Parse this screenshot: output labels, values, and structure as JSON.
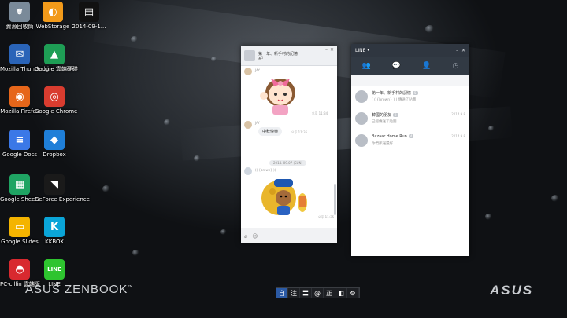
{
  "desktop": {
    "icons": [
      {
        "label": "資源回收筒",
        "color": "#7a8a99",
        "glyph": "🗑",
        "icon": "recycle-bin-icon"
      },
      {
        "label": "WebStorage",
        "color": "#f29a1a",
        "glyph": "◐",
        "icon": "webstorage-icon"
      },
      {
        "label": "2014-09-1...",
        "color": "#111111",
        "glyph": "▤",
        "icon": "screenshot-file-icon"
      },
      {
        "label": "Mozilla Thunderbird",
        "color": "#2a64b8",
        "glyph": "✉",
        "icon": "thunderbird-icon"
      },
      {
        "label": "Google 雲端硬碟",
        "color": "#1e9e55",
        "glyph": "▲",
        "icon": "google-drive-icon"
      },
      {
        "label": "Mozilla Firefox",
        "color": "#e6661a",
        "glyph": "◉",
        "icon": "firefox-icon"
      },
      {
        "label": "Google Chrome",
        "color": "#d93c2f",
        "glyph": "◎",
        "icon": "chrome-icon"
      },
      {
        "label": "Google Docs",
        "color": "#3b78e7",
        "glyph": "≡",
        "icon": "google-docs-icon"
      },
      {
        "label": "Dropbox",
        "color": "#1f7fd8",
        "glyph": "◆",
        "icon": "dropbox-icon"
      },
      {
        "label": "Google Sheets",
        "color": "#1fa463",
        "glyph": "▦",
        "icon": "google-sheets-icon"
      },
      {
        "label": "GeForce Experience",
        "color": "#1a1a1a",
        "glyph": "◥",
        "icon": "geforce-icon"
      },
      {
        "label": "Google Slides",
        "color": "#f4b400",
        "glyph": "▭",
        "icon": "google-slides-icon"
      },
      {
        "label": "KKBOX",
        "color": "#0aa5d8",
        "glyph": "K",
        "icon": "kkbox-icon"
      },
      {
        "label": "PC-cillin 雲端版",
        "color": "#d8292f",
        "glyph": "◓",
        "icon": "pc-cillin-icon"
      },
      {
        "label": "LINE",
        "color": "#2ec42f",
        "glyph": "LINE",
        "icon": "line-app-icon"
      }
    ],
    "brand_left": "ASUS ZENBOOK",
    "brand_left_tm": "™",
    "brand_right": "ASUS"
  },
  "chat_window": {
    "title": "第一年、新手村的記憶",
    "member_count": "▲5",
    "bubble_text": "中秋快樂",
    "date_label": "2014. 09.07 (SUN)",
    "sticker_caption": "(( {brown} ))",
    "time_1": "오후 11:34",
    "time_2": "오후 11:35",
    "time_3": "오후 11:35",
    "sender": "JAY",
    "footer_icons": [
      "paperclip",
      "emoticon"
    ]
  },
  "line_window": {
    "app_title": "LINE",
    "tabs": [
      "friends",
      "chats",
      "add-friend",
      "timeline"
    ],
    "chats": [
      {
        "name": "第一年、新手村的記憶",
        "count": "5",
        "preview": "( ( {brown} ) ) 傳送了貼圖",
        "time": ""
      },
      {
        "name": "韓國的朋友",
        "count": "2",
        "preview": "已經傳送了貼圖",
        "time": "2014.9.8"
      },
      {
        "name": "Bazaar Home Run",
        "count": "4",
        "preview": "你們那邊還好",
        "time": "2014.9.8"
      }
    ]
  },
  "ime_bar": [
    "自",
    "注",
    "〓",
    "@",
    "正",
    "◧",
    "⚙"
  ],
  "colors": {
    "line_dark": "#2f3640",
    "ime_active": "#2b5aa5"
  }
}
